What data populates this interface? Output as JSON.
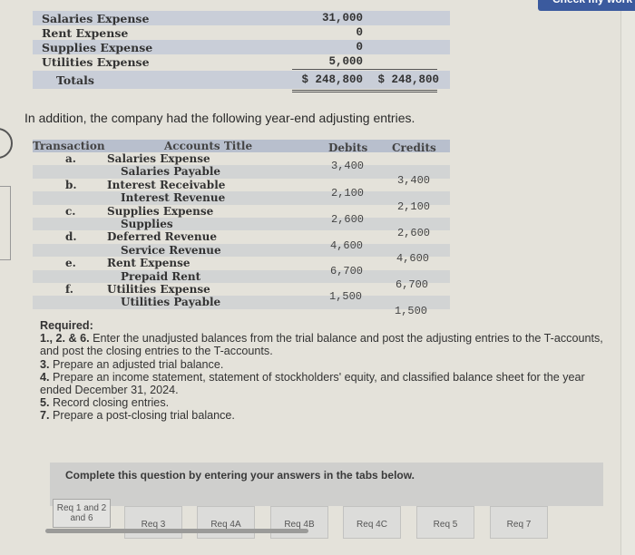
{
  "header": {
    "check_button_label": "Check my work"
  },
  "trial_balance": {
    "rows": [
      {
        "account": "Salaries Expense",
        "debit": "31,000",
        "credit": ""
      },
      {
        "account": "Rent Expense",
        "debit": "0",
        "credit": ""
      },
      {
        "account": "Supplies Expense",
        "debit": "0",
        "credit": ""
      },
      {
        "account": "Utilities Expense",
        "debit": "5,000",
        "credit": ""
      }
    ],
    "totals": {
      "label": "Totals",
      "debit": "$ 248,800",
      "credit": "$ 248,800"
    }
  },
  "intro_text": "In addition, the company had the following year-end adjusting entries.",
  "adjusting_entries": {
    "headers": {
      "transaction": "Transaction",
      "account": "Accounts Title",
      "debits": "Debits",
      "credits": "Credits"
    },
    "lines": [
      {
        "tx": "a.",
        "account": "Salaries Expense",
        "debit": "3,400",
        "credit": ""
      },
      {
        "tx": "",
        "account": "Salaries Payable",
        "debit": "",
        "credit": "3,400"
      },
      {
        "tx": "b.",
        "account": "Interest Receivable",
        "debit": "2,100",
        "credit": ""
      },
      {
        "tx": "",
        "account": "Interest Revenue",
        "debit": "",
        "credit": "2,100"
      },
      {
        "tx": "c.",
        "account": "Supplies Expense",
        "debit": "2,600",
        "credit": ""
      },
      {
        "tx": "",
        "account": "Supplies",
        "debit": "",
        "credit": "2,600"
      },
      {
        "tx": "d.",
        "account": "Deferred Revenue",
        "debit": "4,600",
        "credit": ""
      },
      {
        "tx": "",
        "account": "Service Revenue",
        "debit": "",
        "credit": "4,600"
      },
      {
        "tx": "e.",
        "account": "Rent Expense",
        "debit": "6,700",
        "credit": ""
      },
      {
        "tx": "",
        "account": "Prepaid Rent",
        "debit": "",
        "credit": "6,700"
      },
      {
        "tx": "f.",
        "account": "Utilities Expense",
        "debit": "1,500",
        "credit": ""
      },
      {
        "tx": "",
        "account": "Utilities Payable",
        "debit": "",
        "credit": "1,500"
      }
    ]
  },
  "required": {
    "heading": "Required:",
    "items": [
      {
        "num": "1., 2. & 6.",
        "text": " Enter the unadjusted balances from the trial balance and post the adjusting entries to the T-accounts, and post the closing entries to the T-accounts."
      },
      {
        "num": "3.",
        "text": " Prepare an adjusted trial balance."
      },
      {
        "num": "4.",
        "text": " Prepare an income statement, statement of stockholders' equity, and classified balance sheet for the year ended December 31, 2024."
      },
      {
        "num": "5.",
        "text": " Record closing entries."
      },
      {
        "num": "7.",
        "text": " Prepare a post-closing trial balance."
      }
    ]
  },
  "panel": {
    "instruction": "Complete this question by entering your answers in the tabs below."
  },
  "tabs": [
    {
      "label": "Req 1 and 2 and 6",
      "active": true
    },
    {
      "label": "Req 3"
    },
    {
      "label": "Req 4A"
    },
    {
      "label": "Req 4B"
    },
    {
      "label": "Req 4C"
    },
    {
      "label": "Req 5"
    },
    {
      "label": "Req 7"
    }
  ]
}
